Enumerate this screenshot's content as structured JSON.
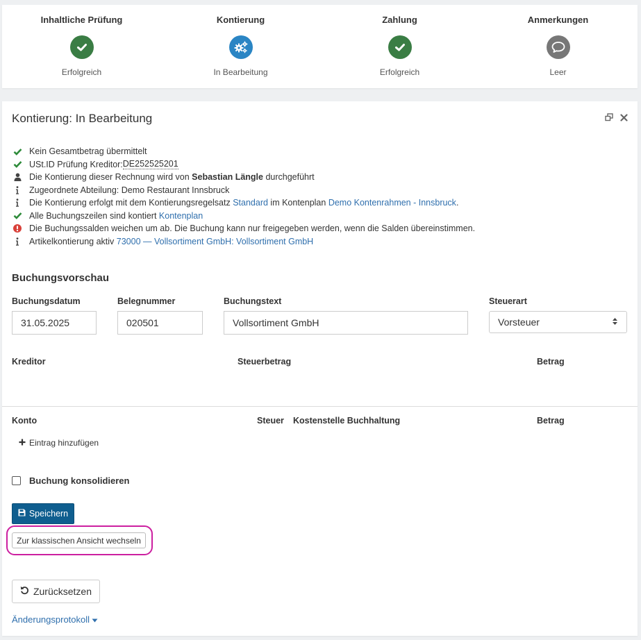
{
  "steps": [
    {
      "title": "Inhaltliche Prüfung",
      "status": "Erfolgreich",
      "icon": "check-icon",
      "color": "#3a7d44"
    },
    {
      "title": "Kontierung",
      "status": "In Bearbeitung",
      "icon": "gears-icon",
      "color": "#2a85c4"
    },
    {
      "title": "Zahlung",
      "status": "Erfolgreich",
      "icon": "check-icon",
      "color": "#3a7d44"
    },
    {
      "title": "Anmerkungen",
      "status": "Leer",
      "icon": "comment-icon",
      "color": "#777777"
    }
  ],
  "panel": {
    "title": "Kontierung: In Bearbeitung"
  },
  "messages": {
    "m1": "Kein Gesamtbetrag übermittelt",
    "m2_pre": "USt.ID Prüfung Kreditor: ",
    "m2_id": "DE252525201",
    "m3_pre": "Die Kontierung dieser Rechnung wird von ",
    "m3_name": "Sebastian Längle",
    "m3_post": " durchgeführt",
    "m4": "Zugeordnete Abteilung: Demo Restaurant Innsbruck",
    "m5_pre": "Die Kontierung erfolgt mit dem Kontierungsregelsatz ",
    "m5_link1": "Standard",
    "m5_mid": " im Kontenplan ",
    "m5_link2": "Demo Kontenrahmen - Innsbruck",
    "m5_post": ".",
    "m6_pre": "Alle Buchungszeilen sind kontiert ",
    "m6_link": "Kontenplan",
    "m7": "Die Buchungssalden weichen um ab. Die Buchung kann nur freigegeben werden, wenn die Salden übereinstimmen.",
    "m8_pre": "Artikelkontierung aktiv ",
    "m8_link": "73000 — Vollsortiment GmbH: Vollsortiment GmbH"
  },
  "preview": {
    "title": "Buchungsvorschau",
    "date_label": "Buchungsdatum",
    "date_value": "31.05.2025",
    "doc_label": "Belegnummer",
    "doc_value": "020501",
    "text_label": "Buchungstext",
    "text_value": "Vollsortiment GmbH",
    "tax_label": "Steuerart",
    "tax_value": "Vorsteuer",
    "creditor_label": "Kreditor",
    "tax_amount_label": "Steuerbetrag",
    "amount_label": "Betrag"
  },
  "table": {
    "konto": "Konto",
    "steuer": "Steuer",
    "kostenstelle": "Kostenstelle Buchhaltung",
    "betrag": "Betrag",
    "add_entry": "Eintrag hinzufügen"
  },
  "consolidate_label": "Buchung konsolidieren",
  "save_label": "Speichern",
  "classic_view_label": "Zur klassischen Ansicht wechseln",
  "reset_label": "Zurücksetzen",
  "changelog_label": "Änderungsprotokoll",
  "colors": {
    "primary": "#0f5e8f",
    "link": "#2f6fad",
    "success": "#2e8b3a",
    "error": "#d9413a",
    "highlight": "#cc1fa0"
  }
}
